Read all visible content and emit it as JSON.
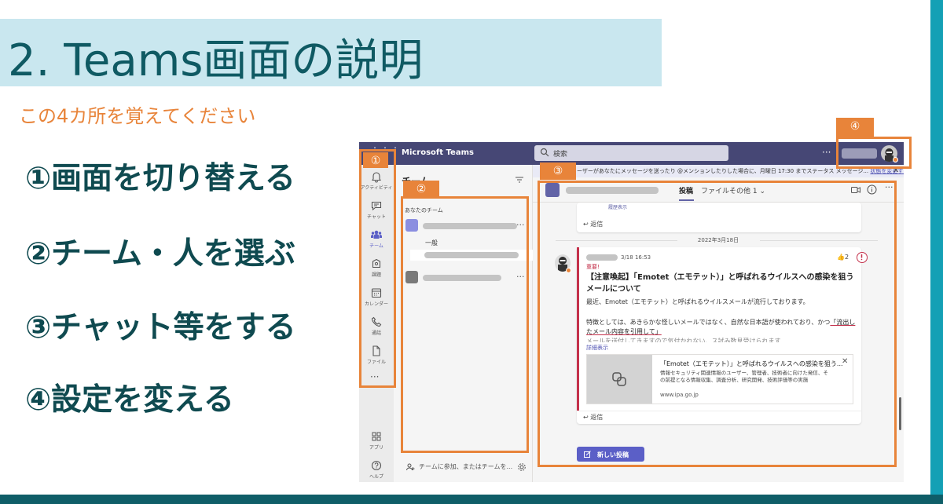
{
  "slide": {
    "title": "2. Teams画面の説明",
    "subtitle": "この4カ所を覚えてください",
    "steps": [
      "①画面を切り替える",
      "②チーム・人を選ぶ",
      "③チャット等をする",
      "④設定を変える"
    ],
    "markers": [
      "①",
      "②",
      "③",
      "④"
    ],
    "colors": {
      "title_band": "#c9e7ef",
      "title_text": "#0f5a63",
      "accent_orange": "#e8843a",
      "step_text": "#0f4a50",
      "teal_bar": "#14a0b5"
    }
  },
  "teams": {
    "app_name": "Microsoft Teams",
    "search_placeholder": "検索",
    "more_label": "···",
    "rail": [
      {
        "icon": "bell-icon",
        "label": "アクティビティ"
      },
      {
        "icon": "chat-icon",
        "label": "チャット"
      },
      {
        "icon": "teams-icon",
        "label": "チーム",
        "active": true
      },
      {
        "icon": "assignment-icon",
        "label": "課題"
      },
      {
        "icon": "calendar-icon",
        "label": "カレンダー"
      },
      {
        "icon": "phone-icon",
        "label": "通話"
      },
      {
        "icon": "file-icon",
        "label": "ファイル"
      }
    ],
    "rail_more": "···",
    "rail_bottom": [
      {
        "icon": "apps-icon",
        "label": "アプリ"
      },
      {
        "icon": "help-icon",
        "label": "ヘルプ"
      }
    ],
    "list": {
      "heading": "チーム",
      "section": "あなたのチーム",
      "channel_general": "一般",
      "join_text": "チームに参加、またはチームを..."
    },
    "notification": {
      "text": "ーザーがあなたにメッセージを送ったり @メンションしたりした場合に、月曜日 17:30 までステータス メッセージ...",
      "link": "状態を変更する。",
      "close": "✕"
    },
    "channel": {
      "tabs": [
        "投稿",
        "ファイル",
        "その他 1"
      ],
      "tab_more_suffix": "⌄"
    },
    "top_snippet": "履歴表示",
    "reply_label": "返信",
    "date_separator": "2022年3月18日",
    "post": {
      "time": "3/18 16:53",
      "likes": "2",
      "important": "重要!",
      "title": "【注意喚起】「Emotet（エモテット）」と呼ばれるウイルスへの感染を狙うメールについて",
      "body1": "最近、Emotet（エモテット）と呼ばれるウイルスメールが流行しております。",
      "body2_pre": "特徴としては、あきらかな怪しいメールではなく、自然な日本語が使われており、かつ",
      "body2_link": "「流出したメール内容を引用して」",
      "faded": "メールを送付してきますので気付かれない、ス試み数見受けられます",
      "detail": "詳細表示",
      "link_card": {
        "title": "「Emotet（エモテット）」と呼ばれるウイルスへの感染を狙う...",
        "desc": "情報セキュリティ関連情報のユーザー、管理者、技術者に向けた発信、その前提となる情報収集、調査分析、研究開発、技術評価等の実施",
        "url": "www.ipa.go.jp",
        "close": "✕"
      }
    },
    "new_post": "新しい投稿"
  }
}
